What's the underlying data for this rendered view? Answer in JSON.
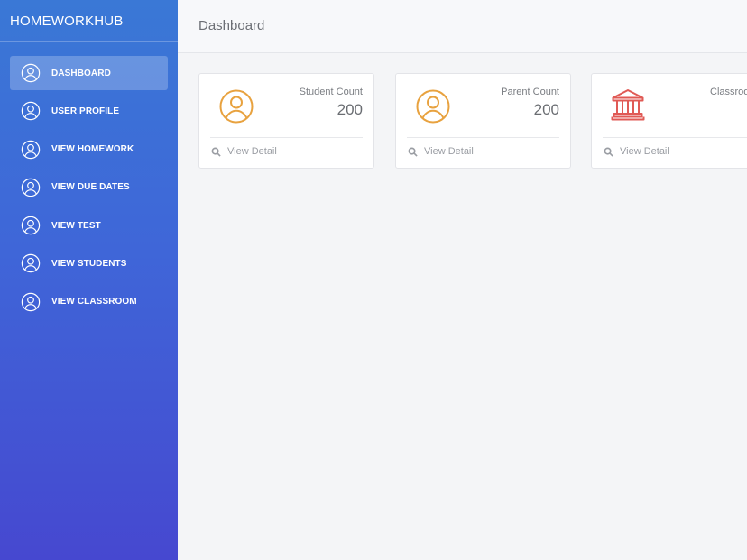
{
  "app": {
    "brand": "HOMEWORKHUB"
  },
  "header": {
    "title": "Dashboard"
  },
  "sidebar": {
    "items": [
      {
        "label": "DASHBOARD",
        "icon": "user-circle-icon",
        "active": true
      },
      {
        "label": "USER PROFILE",
        "icon": "user-circle-icon",
        "active": false
      },
      {
        "label": "VIEW HOMEWORK",
        "icon": "user-circle-icon",
        "active": false
      },
      {
        "label": "VIEW DUE DATES",
        "icon": "user-circle-icon",
        "active": false
      },
      {
        "label": "VIEW TEST",
        "icon": "user-circle-icon",
        "active": false
      },
      {
        "label": "VIEW STUDENTS",
        "icon": "user-circle-icon",
        "active": false
      },
      {
        "label": "VIEW CLASSROOM",
        "icon": "user-circle-icon",
        "active": false
      }
    ]
  },
  "cards": [
    {
      "label": "Student Count",
      "value": "200",
      "icon": "user-circle-icon",
      "color": "#e8a23f",
      "footer": "View Detail"
    },
    {
      "label": "Parent Count",
      "value": "200",
      "icon": "user-circle-icon",
      "color": "#e8a23f",
      "footer": "View Detail"
    },
    {
      "label": "Classroo",
      "value": "",
      "icon": "bank-icon",
      "color": "#e05a55",
      "footer": "View Detail"
    }
  ],
  "colors": {
    "sidebar_top": "#3a78d6",
    "sidebar_bottom": "#4648d0",
    "accent_orange": "#e8a23f",
    "accent_red": "#e05a55"
  }
}
